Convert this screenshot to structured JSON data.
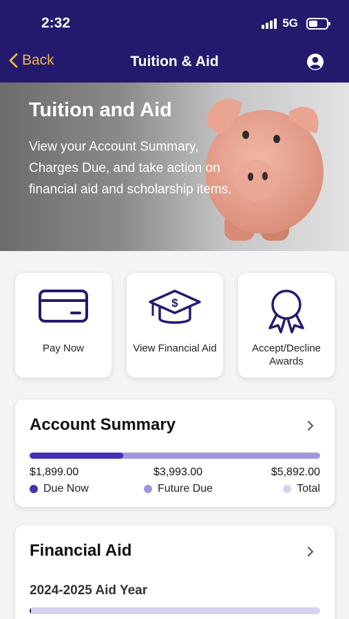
{
  "status_bar": {
    "time": "2:32",
    "network": "5G"
  },
  "nav": {
    "back_label": "Back",
    "title": "Tuition & Aid"
  },
  "hero": {
    "title": "Tuition and Aid",
    "description": "View your Account Summary, Charges Due, and take action on financial aid and scholarship items."
  },
  "actions": [
    {
      "label": "Pay Now",
      "icon": "credit-card-icon"
    },
    {
      "label": "View Financial Aid",
      "icon": "graduation-cap-dollar-icon"
    },
    {
      "label": "Accept/Decline Awards",
      "icon": "award-ribbon-icon"
    }
  ],
  "account_summary": {
    "title": "Account Summary",
    "due_now_amount": "$1,899.00",
    "future_due_amount": "$3,993.00",
    "total_amount": "$5,892.00",
    "due_now_label": "Due Now",
    "future_due_label": "Future Due",
    "total_label": "Total",
    "due_now_fraction": 0.322
  },
  "financial_aid": {
    "title": "Financial Aid",
    "aid_year": "2024-2025 Aid Year",
    "progress_fraction": 0.005
  },
  "colors": {
    "brand": "#231a6e",
    "accent": "#f3b43f",
    "bar_due_now": "#4330b5",
    "bar_future": "#9f97d9",
    "bar_total": "#d6d2f1"
  }
}
